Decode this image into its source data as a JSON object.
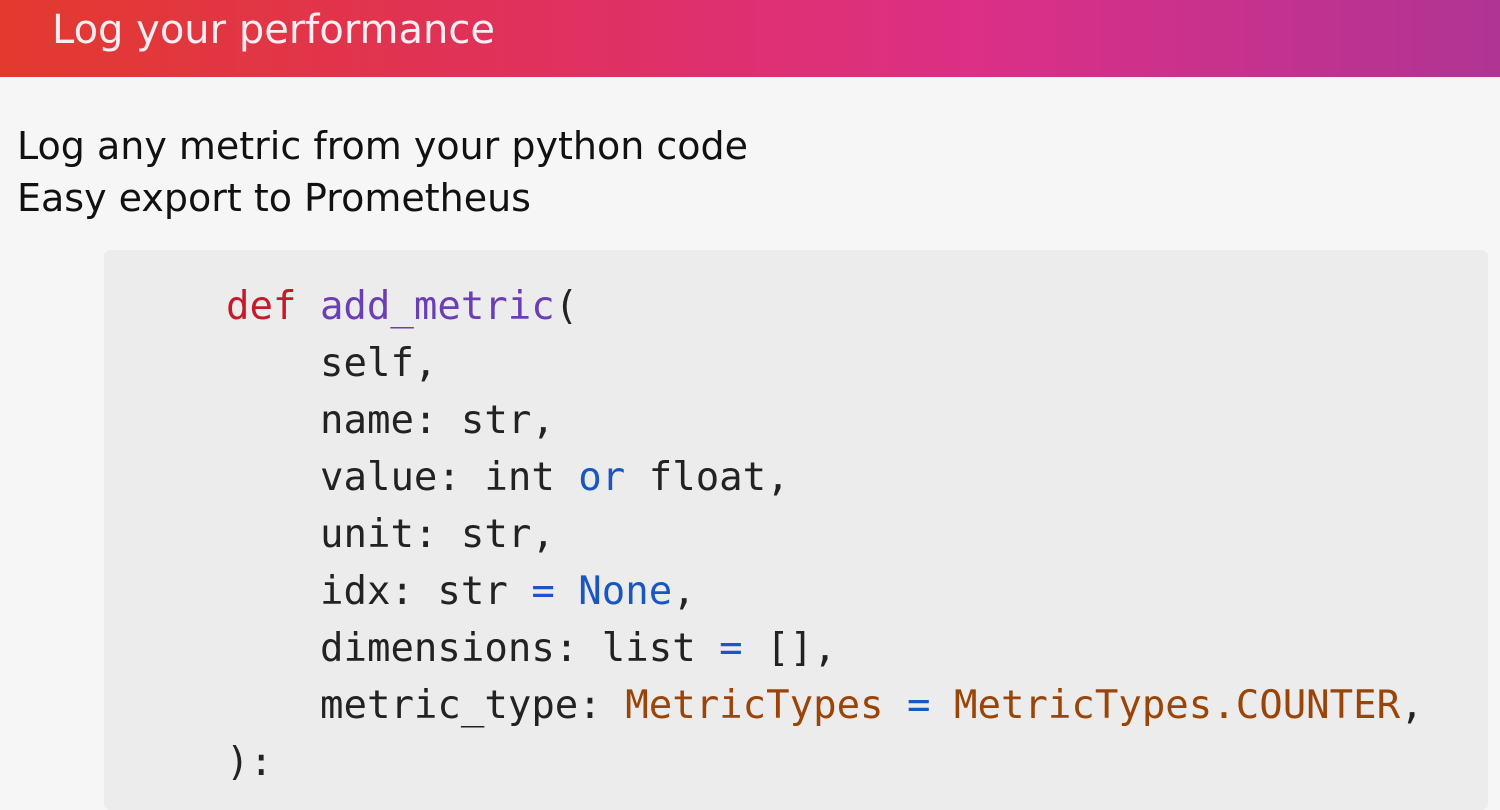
{
  "slide": {
    "title": "Log your performance",
    "bullets": [
      "Log any metric from your python code",
      "Easy export to Prometheus"
    ]
  },
  "code": {
    "def_keyword": "def",
    "function_name": "add_metric",
    "open_paren": "(",
    "params": {
      "self": "self,",
      "name": "name: str,",
      "value_prefix": "value: int ",
      "value_or": "or",
      "value_suffix": " float,",
      "unit": "unit: str,",
      "idx_prefix": "idx: str ",
      "idx_eq": "=",
      "idx_default": "None",
      "idx_suffix": ",",
      "dimensions_prefix": "dimensions: list ",
      "dimensions_eq": "=",
      "dimensions_default": " [],",
      "metric_type_prefix": "metric_type: ",
      "metric_type_annotation": "MetricTypes",
      "metric_type_eq": "=",
      "metric_type_default": "MetricTypes.COUNTER",
      "metric_type_suffix": ","
    },
    "close": "):"
  },
  "colors": {
    "keyword_def": "#c41a2a",
    "function_name": "#6a3fb6",
    "keyword_blue": "#1a56c2",
    "class_name": "#9a4408"
  }
}
